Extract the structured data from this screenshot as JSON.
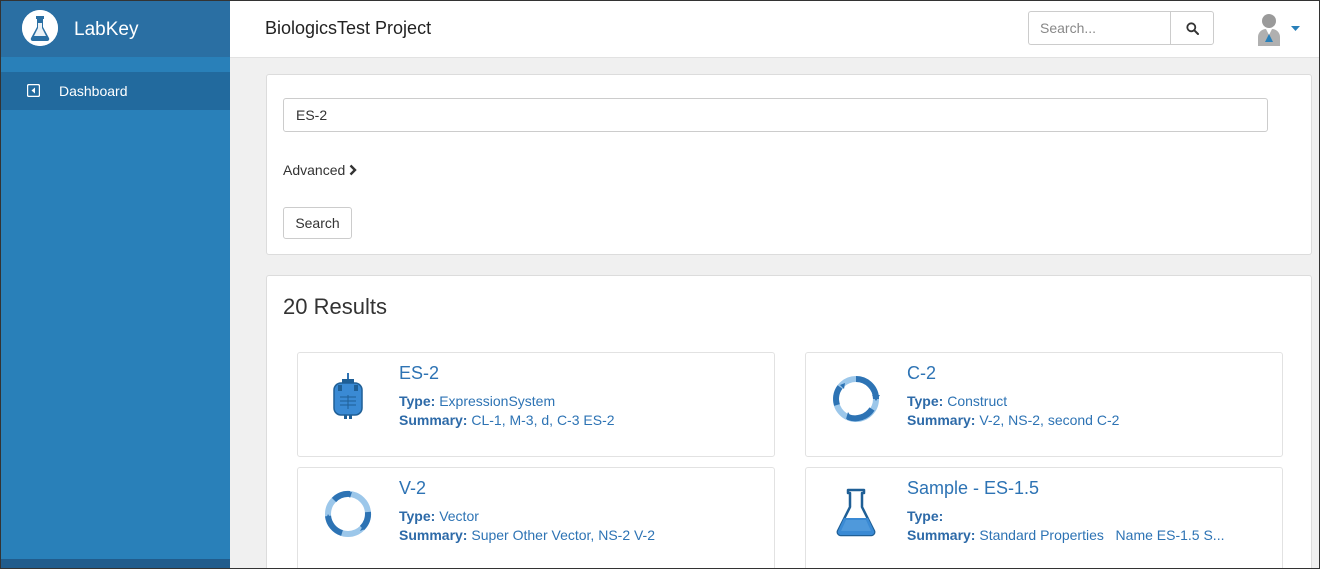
{
  "brand": {
    "name": "LabKey"
  },
  "sidebar": {
    "items": [
      {
        "label": "Dashboard"
      }
    ]
  },
  "header": {
    "title": "BiologicsTest Project",
    "search_placeholder": "Search..."
  },
  "search": {
    "query": "ES-2",
    "advanced_label": "Advanced",
    "button_label": "Search"
  },
  "results": {
    "title": "20 Results",
    "type_label": "Type:",
    "summary_label": "Summary:",
    "items": [
      {
        "name": "ES-2",
        "icon": "expression-system-icon",
        "type": "ExpressionSystem",
        "summary": "CL-1, M-3, d, C-3 ES-2"
      },
      {
        "name": "C-2",
        "icon": "construct-icon",
        "type": "Construct",
        "summary": "V-2, NS-2, second C-2"
      },
      {
        "name": "V-2",
        "icon": "vector-icon",
        "type": "Vector",
        "summary": "Super Other Vector, NS-2 V-2"
      },
      {
        "name": "Sample - ES-1.5",
        "icon": "sample-flask-icon",
        "type": "",
        "summary": "Standard Properties   Name ES-1.5 S..."
      }
    ]
  },
  "colors": {
    "sidebar": "#2980b9",
    "brand_bar": "#2a6fa3",
    "link": "#2d73b4"
  }
}
